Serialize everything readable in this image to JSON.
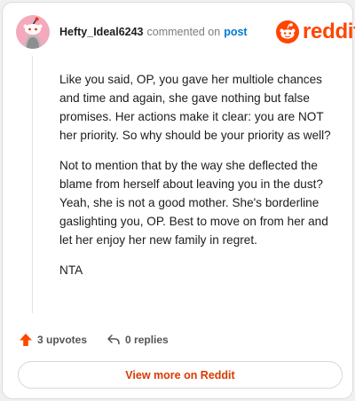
{
  "comment": {
    "username": "Hefty_Ideal6243",
    "action_text": "commented on",
    "post_link": "post",
    "avatar_icon": "snoo-avatar-icon",
    "paragraphs": [
      "Like you said, OP, you gave her multiole chances and time and again, she gave nothing but false promises. Her actions make it clear: you are NOT her priority. So why should be your priority as well?",
      "Not to mention that by the way she deflected the blame from herself about leaving you in the dust? Yeah, she is not a good mother. She's borderline gaslighting you, OP. Best to move on from her and let her enjoy her new family in regret.",
      "NTA"
    ]
  },
  "brand": {
    "logo_text": "reddit",
    "logo_icon": "reddit-alien-icon",
    "accent_color": "#ff4500"
  },
  "actions": {
    "upvotes_label": "3 upvotes",
    "upvote_icon": "upvote-arrow-icon",
    "replies_label": "0 replies",
    "reply_icon": "reply-arrow-icon"
  },
  "footer": {
    "view_more_label": "View more on Reddit"
  },
  "colors": {
    "username": "#1c1c1c",
    "link": "#0079d3",
    "view_more": "#d93a00",
    "avatar_bg": "#f4a9bd"
  }
}
